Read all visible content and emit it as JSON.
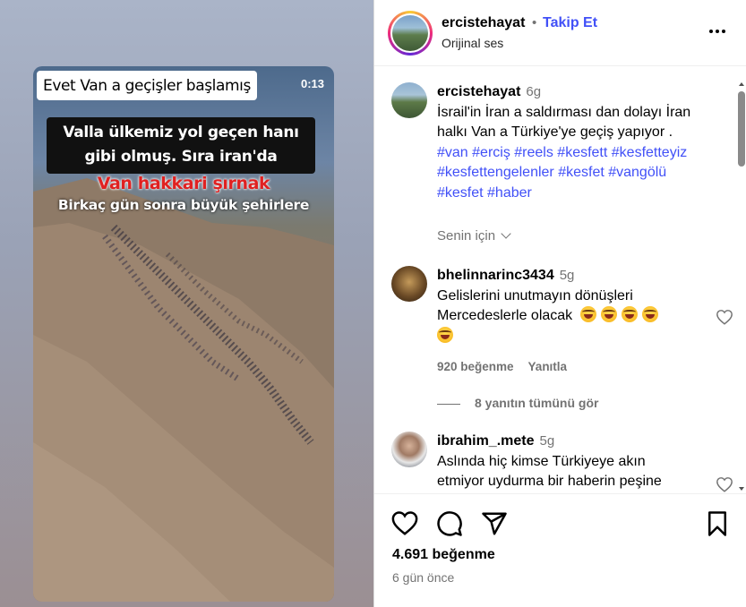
{
  "video": {
    "caption_top": "Evet  Van a geçişler başlamış",
    "duration": "0:13",
    "caption_black_line1": "Valla ülkemiz yol geçen hanı",
    "caption_black_line2": "gibi olmuş. Sıra iran'da",
    "caption_red": "Van hakkari şırnak",
    "caption_white": "Birkaç gün sonra büyük şehirlere"
  },
  "header": {
    "username": "ercistehayat",
    "separator": "•",
    "follow_label": "Takip Et",
    "audio": "Orijinal ses",
    "more_icon": "more-horizontal-icon"
  },
  "post": {
    "username": "ercistehayat",
    "age": "6g",
    "text_line1": "İsrail'in İran a saldırması dan dolayı İran",
    "text_line2": "halkı Van a Türkiye'ye geçiş yapıyor .",
    "tags_line1": "#van #erciş #reels #kesfett #kesfetteyiz",
    "tags_line2": "#kesfettengelenler #kesfet #vangölü",
    "tags_line3": "#kesfet #haber",
    "see_translation": "Senin için"
  },
  "comments": [
    {
      "username": "bhelinnarinc3434",
      "age": "5g",
      "line1": "Gelislerini unutmayın dönüşleri",
      "line2": "Mercedeslerle olacak",
      "likes": "920 beğenme",
      "reply": "Yanıtla",
      "view_replies": "8 yanıtın tümünü gör"
    },
    {
      "username": "ibrahim_.mete",
      "age": "5g",
      "line1": "Aslında hiç kimse Türkiyeye akın",
      "line2": "etmiyor uydurma bir haberin peşine"
    }
  ],
  "footer": {
    "likes": "4.691 beğenme",
    "time": "6 gün önce"
  },
  "colors": {
    "link": "#4150f7",
    "muted": "#737373",
    "caption_red": "#e02121"
  }
}
